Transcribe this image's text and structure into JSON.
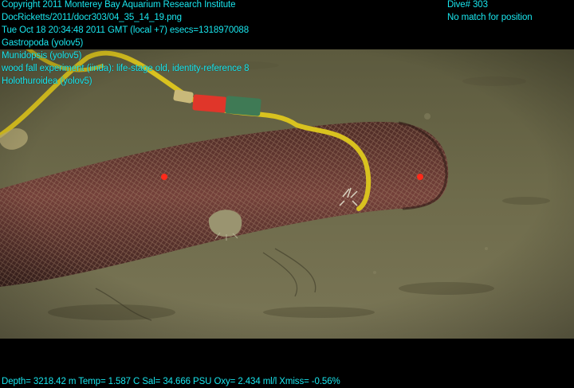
{
  "header": {
    "copyright": "Copyright 2011 Monterey Bay Aquarium Research Institute",
    "file": "DocRicketts/2011/docr303/04_35_14_19.png",
    "timestamp": "Tue Oct 18 20:34:48 2011 GMT (local +7)  esecs=1318970088",
    "dive": "Dive# 303",
    "position_status": "No match for position"
  },
  "annotations": [
    "Gastropoda (yolov5)",
    "Munidopsis (yolov5)",
    "wood fall experiment (iinda): life-stage old, identity-reference 8",
    "Holothuroidea (yolov5)"
  ],
  "footer": {
    "sensor_line": "Depth= 3218.42 m  Temp= 1.587 C  Sal= 34.666 PSU  Oxy= 2.434 ml/l  Xmiss= -0.56%"
  },
  "colors": {
    "overlay_text": "#19e6ee",
    "sediment": "#6e6a4a",
    "log": "#6b3a32",
    "rope": "#d9c21f",
    "laser": "#ff2a1a"
  }
}
